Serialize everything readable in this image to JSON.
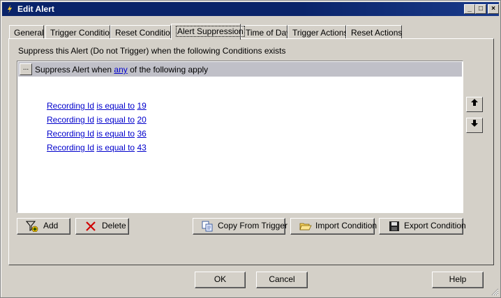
{
  "window": {
    "title": "Edit Alert",
    "min_symbol": "_",
    "max_symbol": "□",
    "close_symbol": "×"
  },
  "tabs": [
    {
      "label": "General"
    },
    {
      "label": "Trigger Condition"
    },
    {
      "label": "Reset Condition"
    },
    {
      "label": "Alert Suppression",
      "active": true
    },
    {
      "label": "Time of Day"
    },
    {
      "label": "Trigger Actions"
    },
    {
      "label": "Reset Actions"
    }
  ],
  "panel": {
    "description": "Suppress this Alert (Do not Trigger) when the following Conditions exists",
    "group": {
      "ellipsis": "...",
      "prefix": "Suppress Alert when",
      "quantifier": "any",
      "suffix": "of the following apply"
    },
    "conditions": [
      {
        "field": "Recording Id",
        "operator": "is equal to",
        "value": "19"
      },
      {
        "field": "Recording Id",
        "operator": "is equal to",
        "value": "20"
      },
      {
        "field": "Recording Id",
        "operator": "is equal to",
        "value": "36"
      },
      {
        "field": "Recording Id",
        "operator": "is equal to",
        "value": "43"
      }
    ],
    "buttons": {
      "add": "Add",
      "delete": "Delete",
      "copy_from_trigger": "Copy From Trigger",
      "import_condition": "Import Condition",
      "export_condition": "Export Condition"
    }
  },
  "footer": {
    "ok": "OK",
    "cancel": "Cancel",
    "help": "Help"
  },
  "colors": {
    "titlebar": "#0a246a",
    "link": "#0000cc",
    "face": "#d4d0c8",
    "delete_x": "#d00000"
  }
}
